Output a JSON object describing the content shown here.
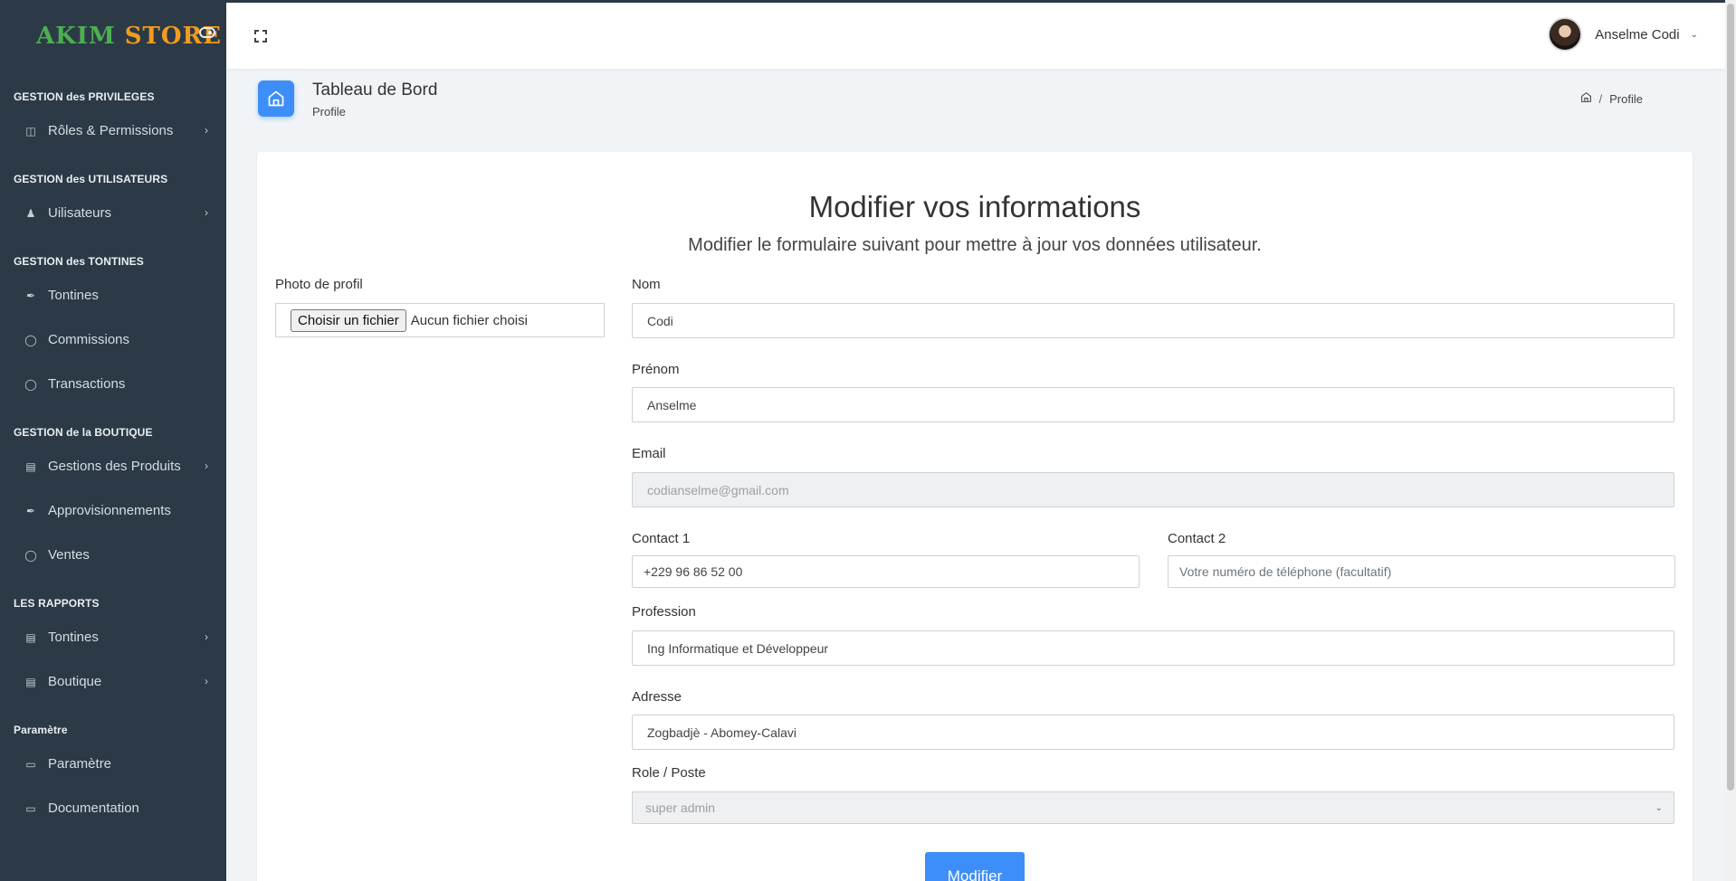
{
  "brand": {
    "part1": "AKIM",
    "part2": "STORE"
  },
  "sidebar": {
    "sections": [
      {
        "title": "GESTION des PRIVILEGES",
        "items": [
          {
            "label": "Rôles & Permissions",
            "icon": "layout-icon",
            "chevron": true
          }
        ]
      },
      {
        "title": "GESTION des UTILISATEURS",
        "items": [
          {
            "label": "Uilisateurs",
            "icon": "users-icon",
            "chevron": true
          }
        ]
      },
      {
        "title": "GESTION des TONTINES",
        "items": [
          {
            "label": "Tontines",
            "icon": "feather-icon",
            "chevron": false
          },
          {
            "label": "Commissions",
            "icon": "shield-icon",
            "chevron": false
          },
          {
            "label": "Transactions",
            "icon": "shield-icon",
            "chevron": false
          }
        ]
      },
      {
        "title": "GESTION de la BOUTIQUE",
        "items": [
          {
            "label": "Gestions des Produits",
            "icon": "clipboard-icon",
            "chevron": true
          },
          {
            "label": "Approvisionnements",
            "icon": "feather-icon",
            "chevron": false
          },
          {
            "label": "Ventes",
            "icon": "shield-icon",
            "chevron": false
          }
        ]
      },
      {
        "title": "LES RAPPORTS",
        "items": [
          {
            "label": "Tontines",
            "icon": "clipboard-icon",
            "chevron": true
          },
          {
            "label": "Boutique",
            "icon": "clipboard-icon",
            "chevron": true
          }
        ]
      },
      {
        "title": "Paramètre",
        "items": [
          {
            "label": "Paramètre",
            "icon": "monitor-icon",
            "chevron": false
          },
          {
            "label": "Documentation",
            "icon": "monitor-icon",
            "chevron": false
          }
        ]
      }
    ]
  },
  "topbar": {
    "user_name": "Anselme Codi"
  },
  "page_header": {
    "title": "Tableau de Bord",
    "subtitle": "Profile",
    "breadcrumb_current": "Profile"
  },
  "form": {
    "title": "Modifier vos informations",
    "subtitle": "Modifier le formulaire suivant pour mettre à jour vos données utilisateur.",
    "photo": {
      "label": "Photo de profil",
      "button": "Choisir un fichier",
      "status": "Aucun fichier choisi"
    },
    "nom": {
      "label": "Nom",
      "value": "Codi"
    },
    "prenom": {
      "label": "Prénom",
      "value": "Anselme"
    },
    "email": {
      "label": "Email",
      "value": "codianselme@gmail.com"
    },
    "contact1": {
      "label": "Contact 1",
      "value": "+229 96 86 52 00"
    },
    "contact2": {
      "label": "Contact 2",
      "placeholder": "Votre numéro de téléphone (facultatif)"
    },
    "profession": {
      "label": "Profession",
      "value": "Ing Informatique et Développeur"
    },
    "adresse": {
      "label": "Adresse",
      "value": "Zogbadjè - Abomey-Calavi"
    },
    "role": {
      "label": "Role / Poste",
      "value": "super admin"
    },
    "submit": "Modifier"
  }
}
